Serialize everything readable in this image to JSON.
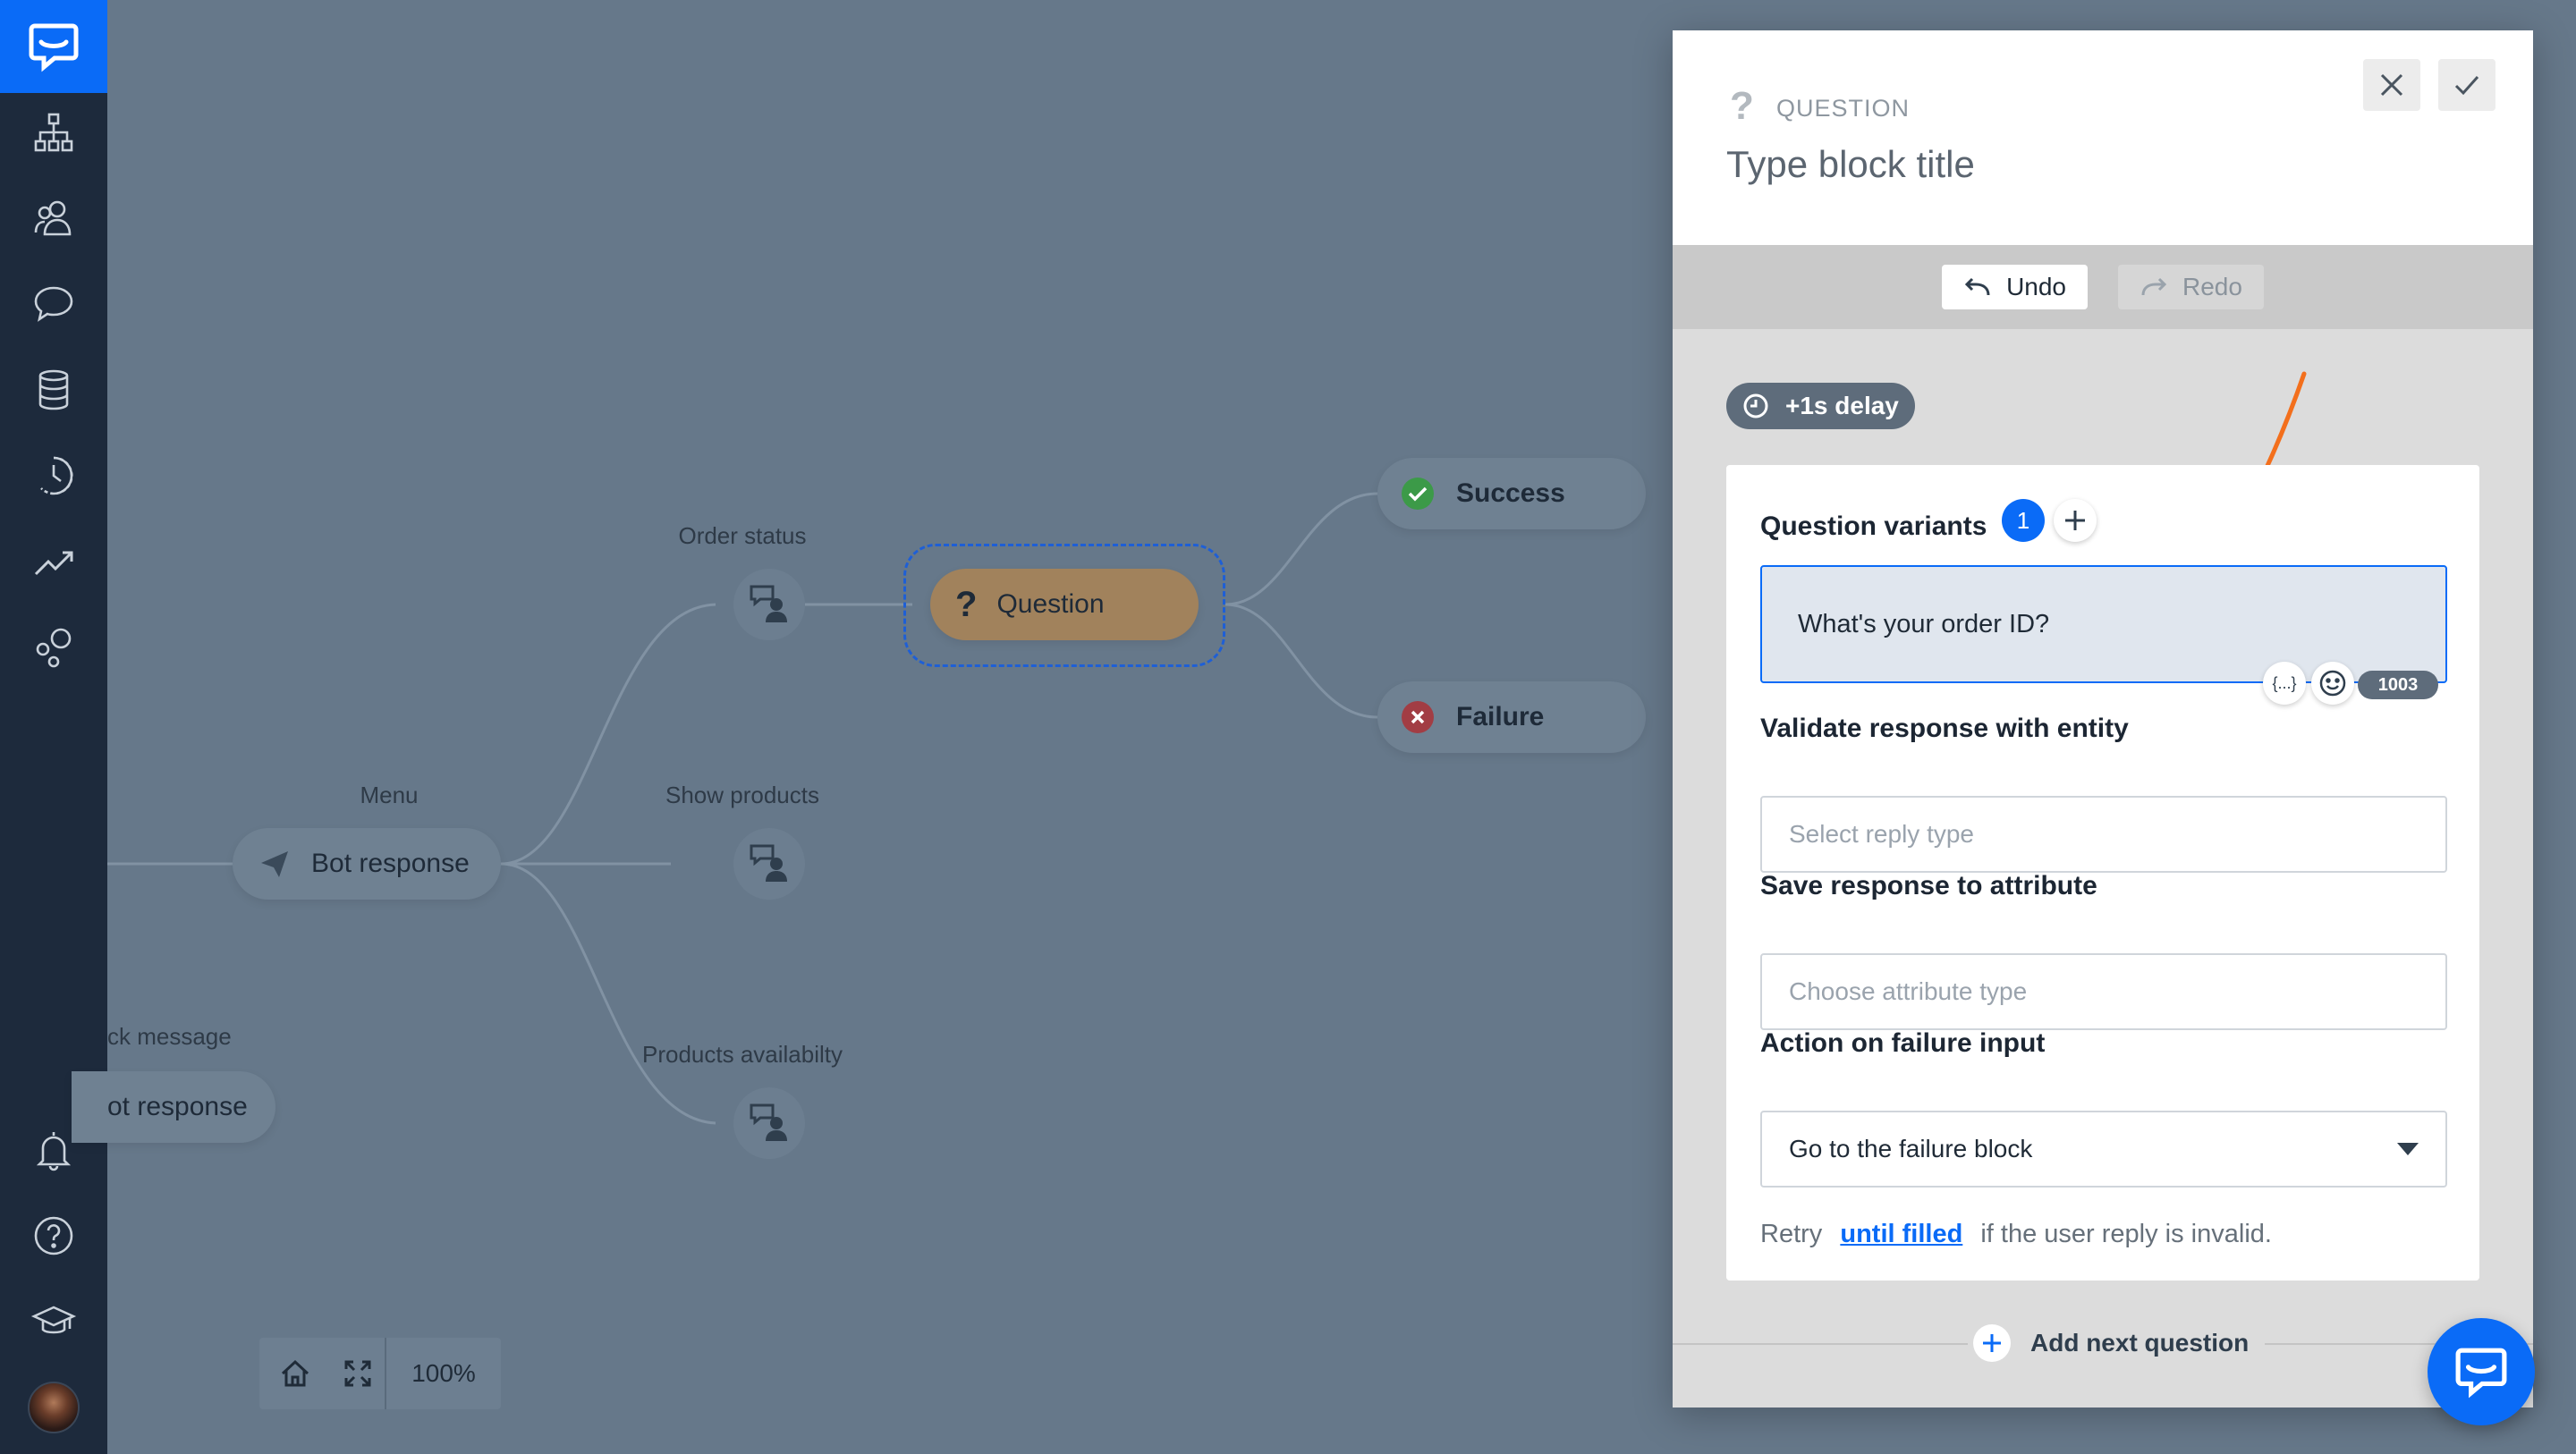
{
  "canvas": {
    "nodes": {
      "menu_label": "Menu",
      "bot_response": "Bot response",
      "fallback_label": "ck message",
      "fallback_response": "ot response",
      "order_status_label": "Order status",
      "show_products_label": "Show products",
      "products_availability_label": "Products availabilty",
      "question": "Question",
      "success": "Success",
      "failure": "Failure"
    },
    "zoom": "100%"
  },
  "panel": {
    "type_label": "QUESTION",
    "title_placeholder": "Type block title",
    "undo_label": "Undo",
    "redo_label": "Redo",
    "delay_label": "+1s delay",
    "question_variants_label": "Question variants",
    "variants_count": "1",
    "variant_text": "What's your order ID?",
    "variable_glyph": "{...}",
    "char_count": "1003",
    "validate_label": "Validate response with entity",
    "validate_placeholder": "Select reply type",
    "save_label": "Save response to attribute",
    "save_placeholder": "Choose attribute type",
    "failure_action_label": "Action on failure input",
    "failure_action_value": "Go to the failure block",
    "retry_prefix": "Retry",
    "retry_link": "until filled",
    "retry_suffix": "if the user reply is invalid.",
    "add_next_label": "Add next question"
  },
  "colors": {
    "sidebar": "#1d2a3c",
    "brand": "#0a6bf7",
    "canvas": "#66788a",
    "question_node": "#a1825c",
    "arrow": "#f36f1c",
    "link": "#0a6bf7"
  }
}
